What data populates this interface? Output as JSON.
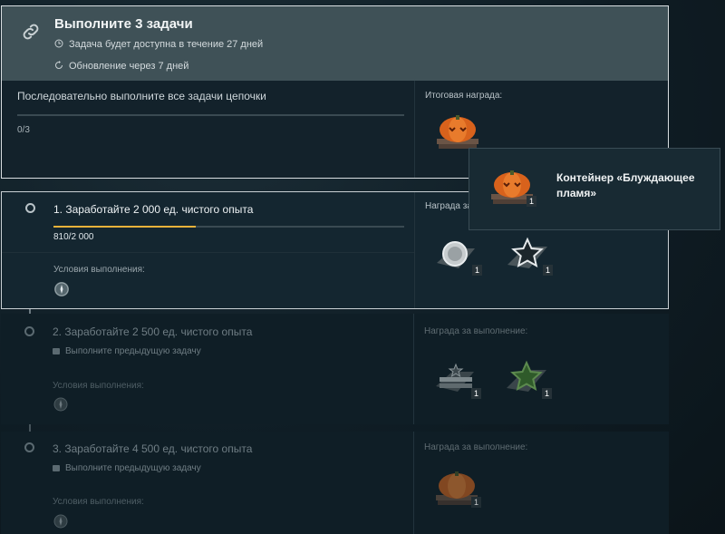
{
  "header": {
    "title": "Выполните 3 задачи",
    "availability": "Задача будет доступна в течение 27 дней",
    "refresh": "Обновление через 7 дней",
    "instruction": "Последовательно выполните все задачи цепочки",
    "chain_progress": "0/3",
    "chain_progress_fraction": 0,
    "final_reward_label": "Итоговая награда:"
  },
  "tooltip": {
    "title": "Контейнер «Блуждающее пламя»",
    "qty": "1"
  },
  "tasks": [
    {
      "title": "1. Заработайте 2 000 ед. чистого опыта",
      "progress": "810/2 000",
      "progress_fraction": 0.405,
      "conditions_label": "Условия выполнения:",
      "reward_label": "Награда за выполнение:",
      "reward_label_visible": "Награда за",
      "rewards": [
        {
          "icon": "silver-medal-icon",
          "qty": "1"
        },
        {
          "icon": "star-flag-icon",
          "qty": "1"
        }
      ]
    },
    {
      "title": "2. Заработайте 2 500 ед. чистого опыта",
      "locked": "Выполните предыдущую задачу",
      "conditions_label": "Условия выполнения:",
      "reward_label": "Награда за выполнение:",
      "rewards": [
        {
          "icon": "camouflage-icon",
          "qty": "1"
        },
        {
          "icon": "green-star-icon",
          "qty": "1"
        }
      ]
    },
    {
      "title": "3. Заработайте 4 500 ед. чистого опыта",
      "locked": "Выполните предыдущую задачу",
      "conditions_label": "Условия выполнения:",
      "reward_label": "Награда за выполнение:",
      "rewards": [
        {
          "icon": "pumpkin-container-icon",
          "qty": "1"
        }
      ]
    }
  ],
  "colors": {
    "accent": "#e9b23a",
    "header_bg": "#3f5157",
    "panel_bg": "#13222b"
  }
}
